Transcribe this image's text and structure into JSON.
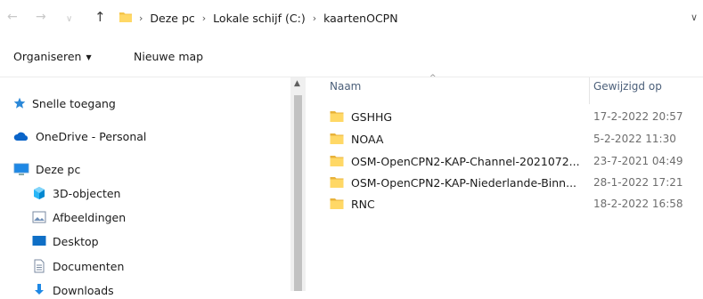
{
  "address_bar": {
    "nav_back_glyph": "←",
    "nav_forward_glyph": "→",
    "recent_glyph": "∨",
    "up_glyph": "↑",
    "crumbs": [
      "Deze pc",
      "Lokale schijf (C:)",
      "kaartenOCPN"
    ],
    "separator": "›",
    "dropdown_glyph": "∨"
  },
  "toolbar": {
    "organize_label": "Organiseren",
    "new_folder_label": "Nieuwe map"
  },
  "nav_pane": {
    "items": [
      {
        "label": "Snelle toegang",
        "icon": "star-icon"
      },
      {
        "label": "OneDrive - Personal",
        "icon": "cloud-icon"
      },
      {
        "label": "Deze pc",
        "icon": "computer-icon"
      },
      {
        "label": "3D-objecten",
        "icon": "cube-icon"
      },
      {
        "label": "Afbeeldingen",
        "icon": "pictures-icon"
      },
      {
        "label": "Desktop",
        "icon": "desktop-icon"
      },
      {
        "label": "Documenten",
        "icon": "document-icon"
      },
      {
        "label": "Downloads",
        "icon": "download-icon"
      }
    ]
  },
  "file_list": {
    "columns": [
      "Naam",
      "Gewijzigd op"
    ],
    "sort_glyph": "^",
    "rows": [
      {
        "name": "GSHHG",
        "modified": "17-2-2022 20:57"
      },
      {
        "name": "NOAA",
        "modified": "5-2-2022 11:30"
      },
      {
        "name": "OSM-OpenCPN2-KAP-Channel-2021072...",
        "modified": "23-7-2021 04:49"
      },
      {
        "name": "OSM-OpenCPN2-KAP-Niederlande-Binn...",
        "modified": "28-1-2022 17:21"
      },
      {
        "name": "RNC",
        "modified": "18-2-2022 16:58"
      }
    ]
  },
  "colors": {
    "folder": "#f4c44a",
    "accent_blue": "#0078d4",
    "header_text": "#4c607a"
  }
}
